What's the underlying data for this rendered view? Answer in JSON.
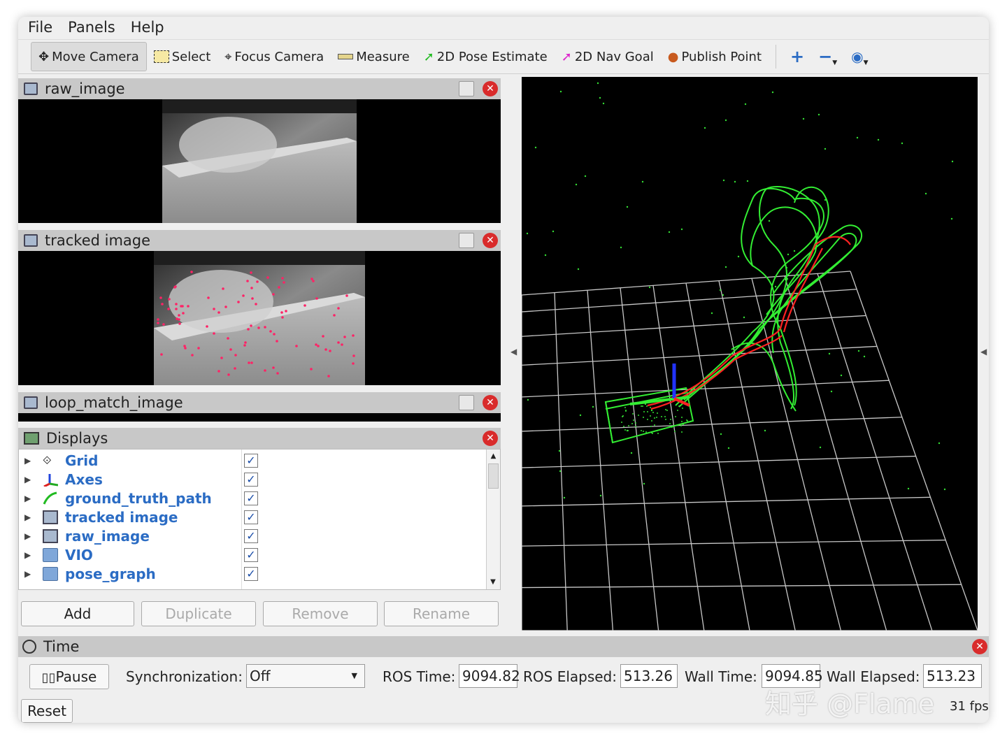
{
  "menu": [
    "File",
    "Panels",
    "Help"
  ],
  "toolbar": {
    "move_camera": "Move Camera",
    "select": "Select",
    "focus_camera": "Focus Camera",
    "measure": "Measure",
    "pose_estimate": "2D Pose Estimate",
    "nav_goal": "2D Nav Goal",
    "publish_point": "Publish Point"
  },
  "panels": {
    "raw_image": "raw_image",
    "tracked_image": "tracked image",
    "loop_match_image": "loop_match_image",
    "displays": "Displays"
  },
  "displays": {
    "items": [
      {
        "label": "Grid",
        "icon": "grid-icon",
        "checked": true
      },
      {
        "label": "Axes",
        "icon": "axes-icon",
        "checked": true
      },
      {
        "label": "ground_truth_path",
        "icon": "path-icon",
        "checked": true
      },
      {
        "label": "tracked image",
        "icon": "image-icon",
        "checked": true
      },
      {
        "label": "raw_image",
        "icon": "image-icon",
        "checked": true
      },
      {
        "label": "VIO",
        "icon": "folder-icon",
        "checked": true
      },
      {
        "label": "pose_graph",
        "icon": "folder-icon",
        "checked": true
      }
    ],
    "buttons": {
      "add": "Add",
      "duplicate": "Duplicate",
      "remove": "Remove",
      "rename": "Rename"
    }
  },
  "time": {
    "title": "Time",
    "pause": "Pause",
    "sync_label": "Synchronization:",
    "sync_value": "Off",
    "ros_time_label": "ROS Time:",
    "ros_time": "9094.82",
    "ros_elapsed_label": "ROS Elapsed:",
    "ros_elapsed": "513.26",
    "wall_time_label": "Wall Time:",
    "wall_time": "9094.85",
    "wall_elapsed_label": "Wall Elapsed:",
    "wall_elapsed": "513.23",
    "reset": "Reset",
    "fps": "31 fps"
  },
  "watermark": "知乎 @Flame",
  "colors": {
    "path_green": "#33ee33",
    "path_red": "#ff2222",
    "grid": "#c8c8c8",
    "close_red": "#d92b2b",
    "display_blue": "#2b6cc4"
  }
}
